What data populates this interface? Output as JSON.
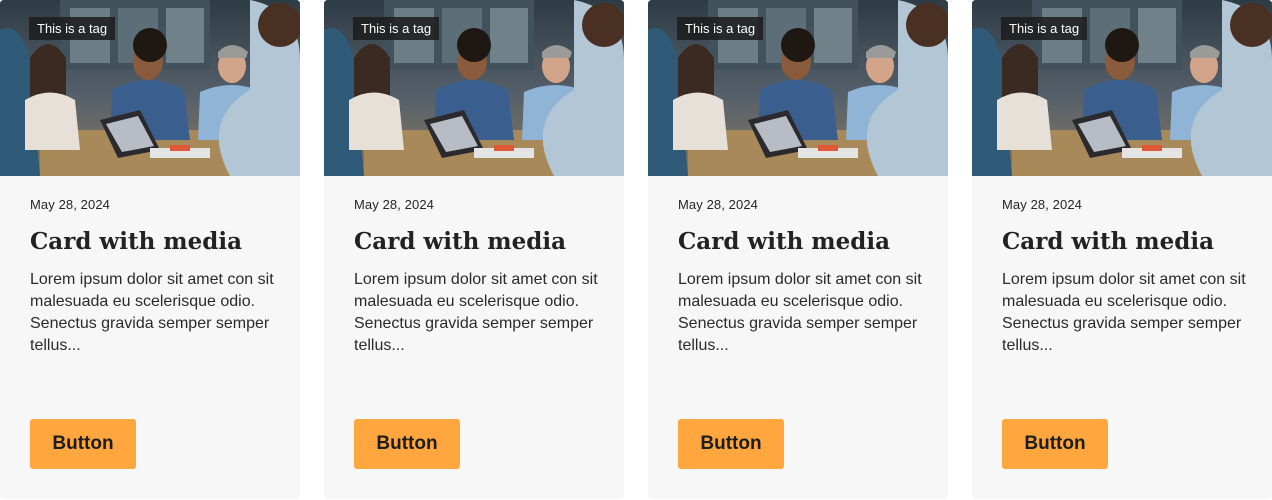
{
  "cards": [
    {
      "tag": "This is a tag",
      "date": "May 28, 2024",
      "title": "Card with media",
      "description": "Lorem ipsum dolor sit amet con sit malesuada eu scelerisque odio. Senectus gravida semper semper tellus...",
      "button_label": "Button",
      "image_icon": "team-meeting-photo"
    },
    {
      "tag": "This is a tag",
      "date": "May 28, 2024",
      "title": "Card with media",
      "description": "Lorem ipsum dolor sit amet con sit malesuada eu scelerisque odio. Senectus gravida semper semper tellus...",
      "button_label": "Button",
      "image_icon": "team-meeting-photo"
    },
    {
      "tag": "This is a tag",
      "date": "May 28, 2024",
      "title": "Card with media",
      "description": "Lorem ipsum dolor sit amet con sit malesuada eu scelerisque odio. Senectus gravida semper semper tellus...",
      "button_label": "Button",
      "image_icon": "team-meeting-photo"
    },
    {
      "tag": "This is a tag",
      "date": "May 28, 2024",
      "title": "Card with media",
      "description": "Lorem ipsum dolor sit amet con sit malesuada eu scelerisque odio. Senectus gravida semper semper tellus...",
      "button_label": "Button",
      "image_icon": "team-meeting-photo"
    }
  ],
  "colors": {
    "card_background": "#f7f7f7",
    "button_background": "#ffa63e",
    "tag_background": "#1e1e1e",
    "text": "#222222"
  }
}
